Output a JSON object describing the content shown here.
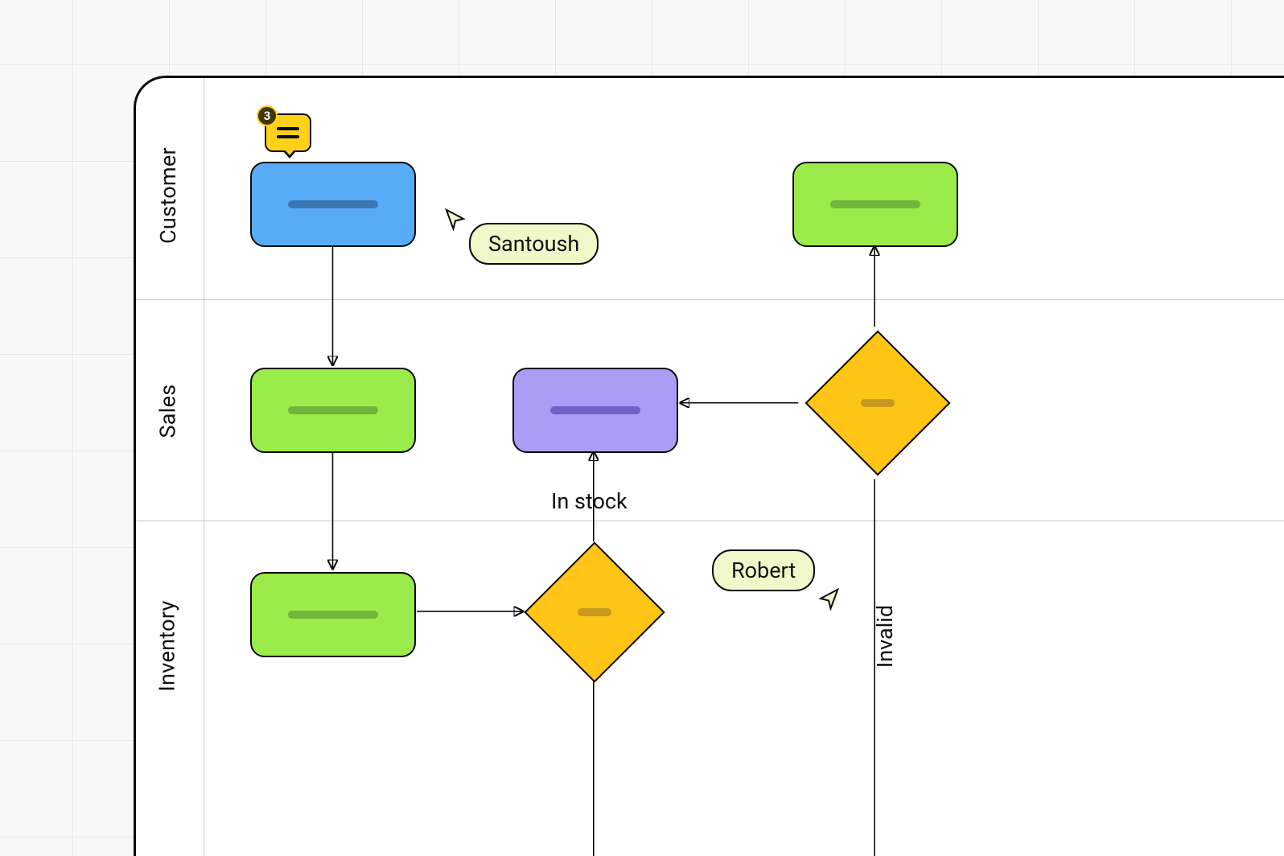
{
  "lanes": {
    "l1": "Customer",
    "l2": "Sales",
    "l3": "Inventory"
  },
  "edges": {
    "in_stock": "In stock",
    "invalid": "Invalid"
  },
  "comment": {
    "count": "3"
  },
  "cursors": {
    "santoush": "Santoush",
    "robert": "Robert"
  },
  "colors": {
    "blue": "#58abf6",
    "green": "#9beb4a",
    "purple": "#ab9df6",
    "yellow": "#ffc516",
    "pale": "#eef8c8"
  }
}
